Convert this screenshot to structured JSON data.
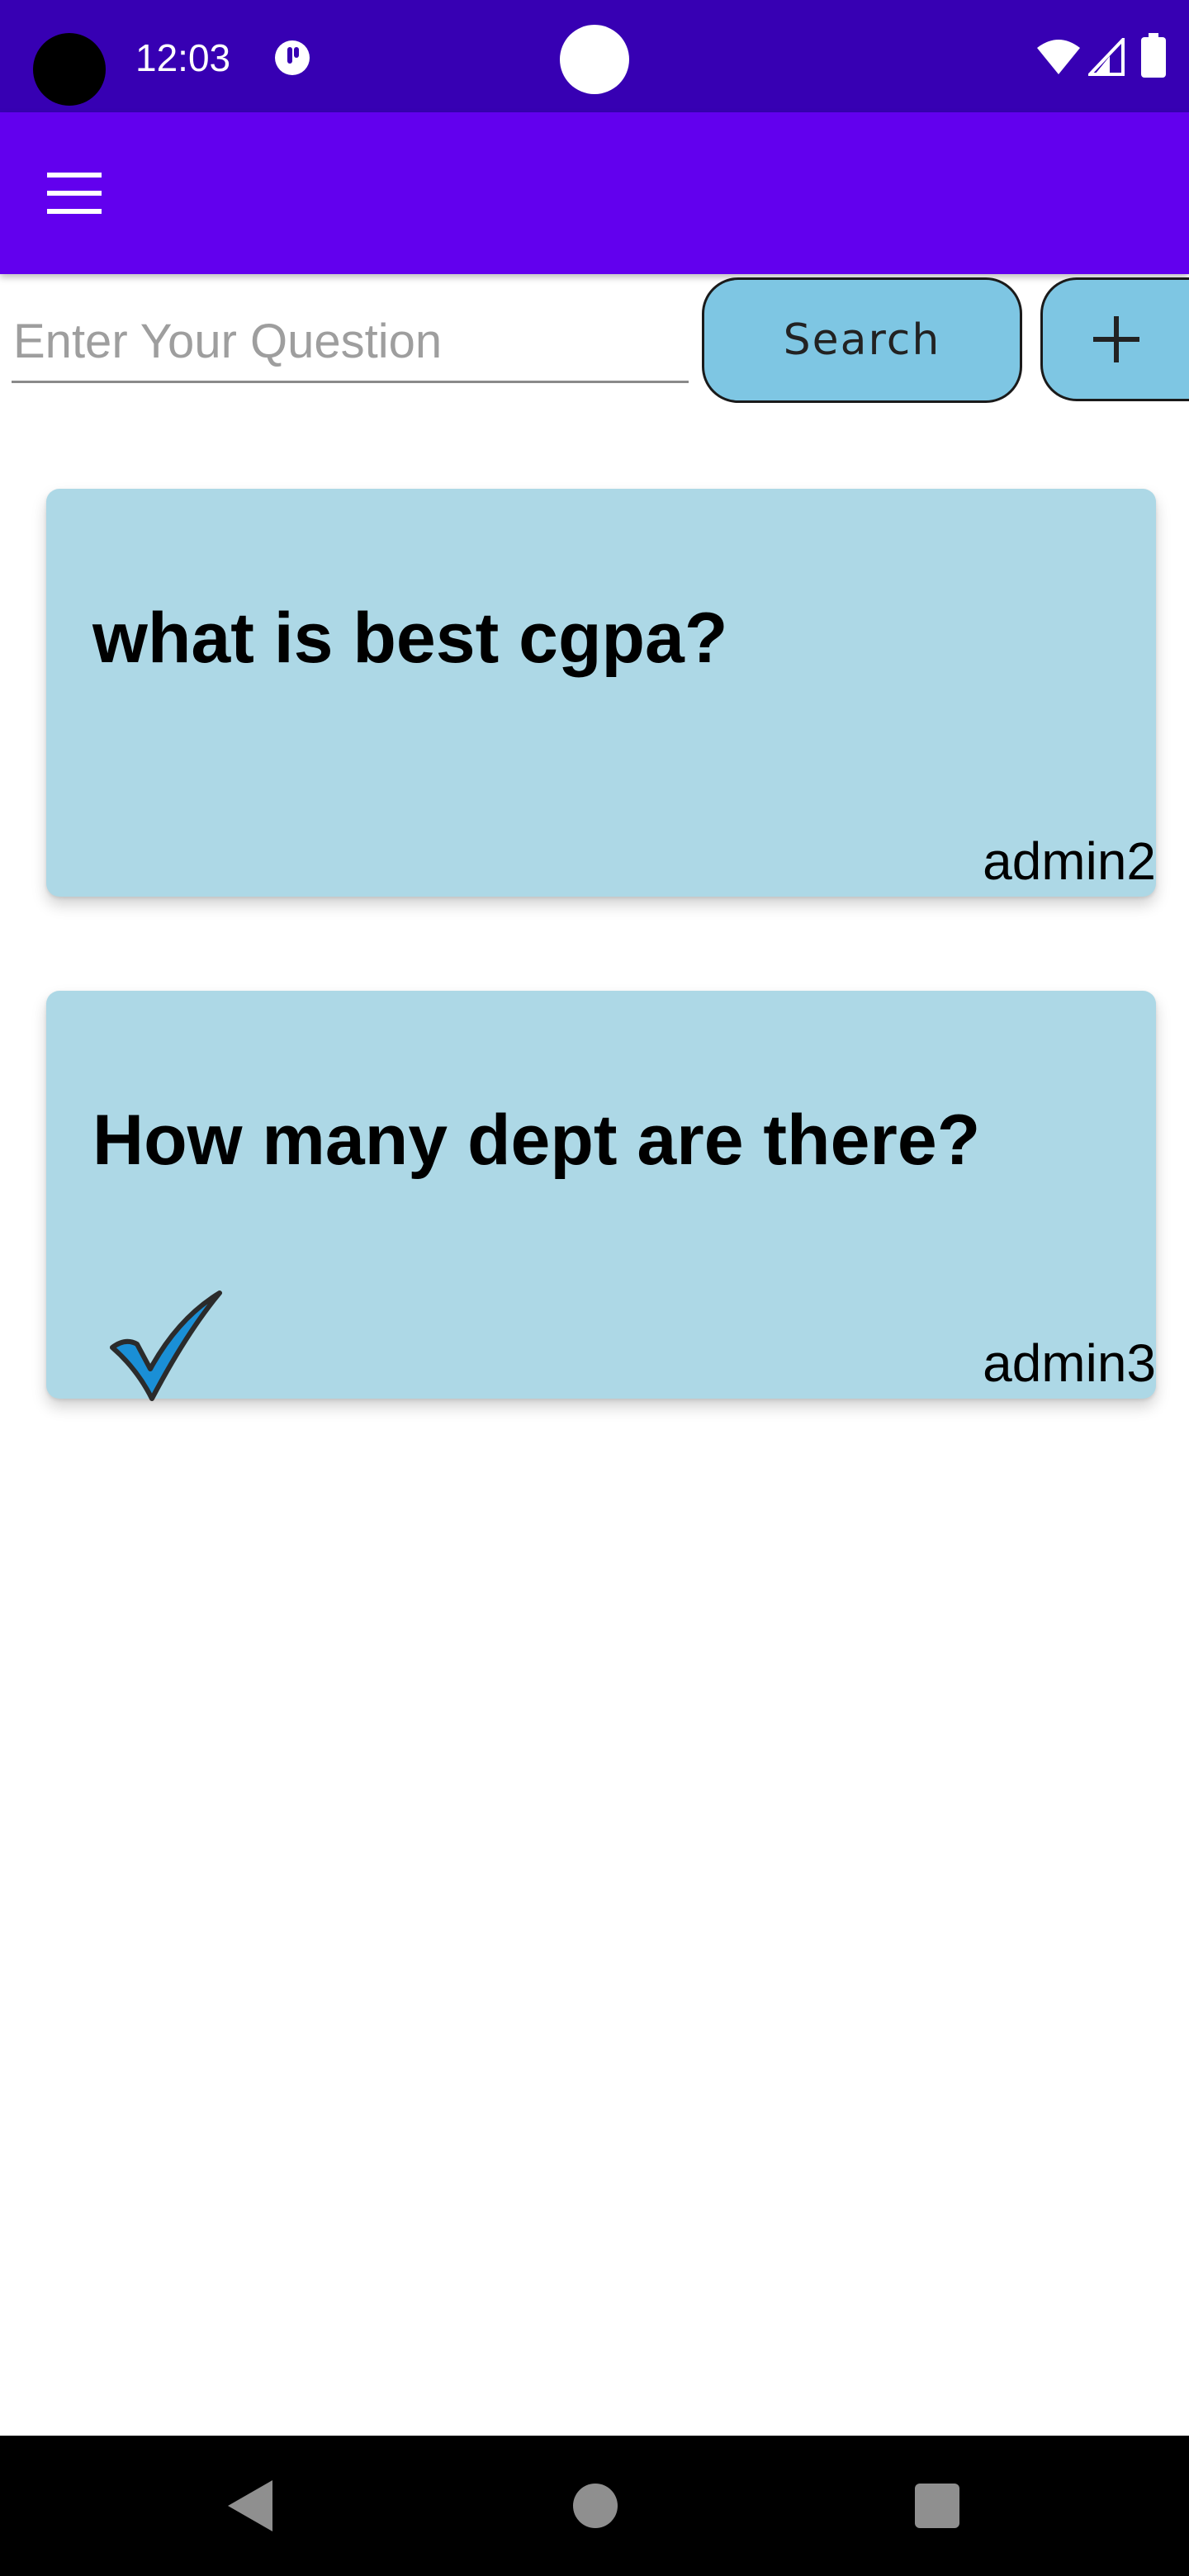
{
  "status_bar": {
    "time": "12:03",
    "icons": [
      "app-indicator-icon",
      "wifi-icon",
      "signal-icon",
      "battery-icon"
    ]
  },
  "app_bar": {
    "menu_icon": "hamburger-menu-icon",
    "color": "#6200ee"
  },
  "search": {
    "placeholder": "Enter Your Question",
    "value": "",
    "button_label": "Search",
    "add_icon": "plus-icon"
  },
  "questions": [
    {
      "text": "what is best cgpa?",
      "author": "admin2",
      "answered": false
    },
    {
      "text": "How many dept are there?",
      "author": "admin3",
      "answered": true
    }
  ],
  "colors": {
    "status_bar": "#3700b3",
    "app_bar": "#6200ee",
    "button_bg": "#7ec6e3",
    "card_bg": "#add8e6",
    "check_blue": "#1a8fd6"
  },
  "nav_bar": {
    "icons": [
      "back-icon",
      "home-icon",
      "recents-icon"
    ]
  }
}
